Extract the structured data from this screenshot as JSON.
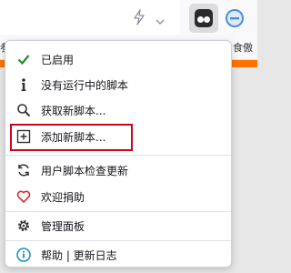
{
  "toolbar": {
    "tracking_icon": "lightning-bolt-icon",
    "dropdown_icon": "chevron-down-icon",
    "extension_icon": "tampermonkey-icon",
    "blocker_icon": "circle-minus-icon"
  },
  "bookmarks": {
    "left_fragment": "参",
    "right_fragment": "食傲"
  },
  "menu": {
    "items": [
      {
        "label": "已启用",
        "icon": "check-icon"
      },
      {
        "label": "没有运行中的脚本",
        "icon": "info-icon"
      },
      {
        "label": "获取新脚本...",
        "icon": "search-icon"
      },
      {
        "label": "添加新脚本...",
        "icon": "plus-square-icon"
      },
      {
        "label": "用户脚本检查更新",
        "icon": "refresh-icon"
      },
      {
        "label": "欢迎捐助",
        "icon": "heart-icon"
      },
      {
        "label": "管理面板",
        "icon": "gear-icon"
      },
      {
        "label": "帮助 | 更新日志",
        "icon": "info-circle-icon"
      }
    ]
  },
  "colors": {
    "check": "#2a8a2a",
    "heart": "#d62d2d",
    "info": "#1a8bc4",
    "highlight": "#d0021b",
    "page_accent": "#ff7300"
  }
}
